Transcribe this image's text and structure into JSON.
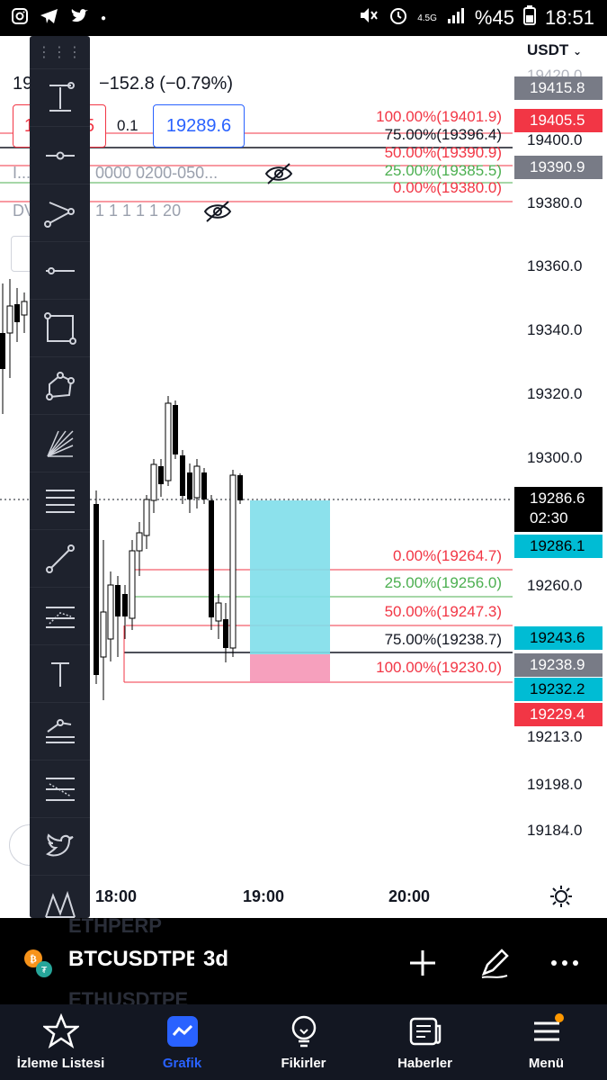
{
  "status": {
    "network": "4.5G",
    "battery": "%45",
    "time": "18:51"
  },
  "chart": {
    "currency": "USDT",
    "price_axis": [
      "19420.0",
      "19400.0",
      "19380.0",
      "19360.0",
      "19340.0",
      "19320.0",
      "19300.0",
      "19260.0",
      "19213.0",
      "19198.0",
      "19184.0"
    ],
    "time_axis": [
      "18:00",
      "19:00",
      "20:00"
    ],
    "tags": {
      "t1": "19415.8",
      "t2": "19405.5",
      "t3": "19390.9",
      "current_price": "19286.6",
      "countdown": "02:30",
      "t4": "19286.1",
      "t5": "19243.6",
      "t6": "19238.9",
      "t7": "19232.2",
      "t8": "19229.4"
    },
    "fib_top": [
      "100.00%(19401.9)",
      "75.00%(19396.4)",
      "50.00%(19390.9)",
      "25.00%(19385.5)",
      "0.00%(19380.0)"
    ],
    "fib_bottom": [
      "0.00%(19264.7)",
      "25.00%(19256.0)",
      "50.00%(19247.3)",
      "75.00%(19238.7)",
      "100.00%(19230.0)"
    ],
    "info": {
      "change_prefix": "19",
      "change": "−152.8 (−0.79%)",
      "red_box": "1",
      "red_box_tail": "5",
      "ratio": "0.1",
      "price_box": "19289.6",
      "indicator1": "I...",
      "indicator1_params": "0000 0200-050...",
      "indicator2": "DV",
      "indicator2_params": "1 1 1 1 1 20"
    }
  },
  "symbol": {
    "ghost_above": "ETHPERP",
    "name": "BTCUSDTPERP",
    "timeframe": "3d",
    "ghost_below": "ETHUSDTPE"
  },
  "nav": [
    {
      "label": "İzleme Listesi",
      "icon": "star-icon"
    },
    {
      "label": "Grafik",
      "icon": "chart-icon"
    },
    {
      "label": "Fikirler",
      "icon": "lightbulb-icon"
    },
    {
      "label": "Haberler",
      "icon": "news-icon"
    },
    {
      "label": "Menü",
      "icon": "menu-icon"
    }
  ],
  "colors": {
    "accent": "#2962ff",
    "red": "#f23645",
    "green": "#4caf50",
    "cyan": "#00bcd4",
    "toolbar": "#1e222d"
  }
}
